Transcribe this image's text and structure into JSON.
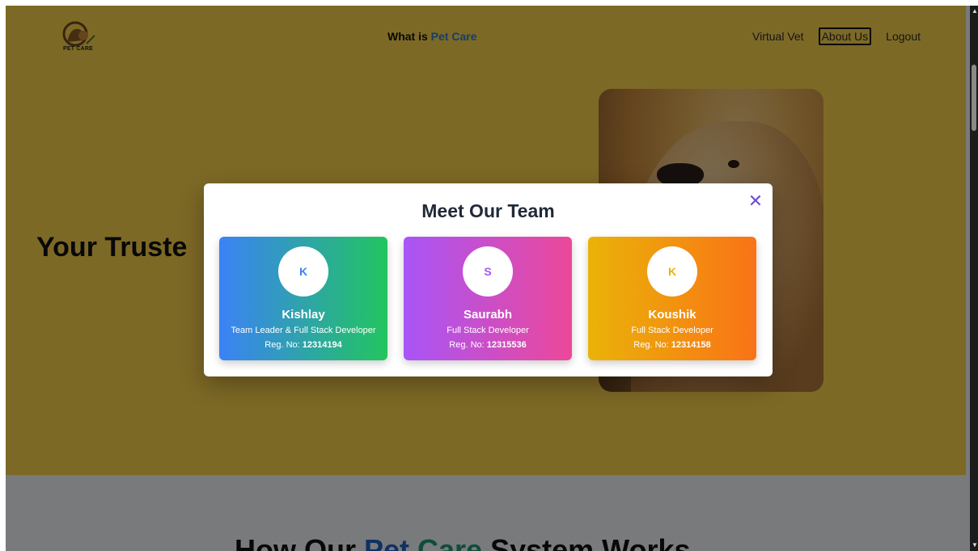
{
  "navbar": {
    "logo_text": "PET CARE",
    "center_prefix": "What is",
    "center_accent": "Pet Care",
    "links": [
      "Virtual Vet",
      "About Us",
      "Logout"
    ]
  },
  "hero": {
    "title": "Your Truste"
  },
  "section2": {
    "title_part1": "How Our ",
    "title_part2": "Pet ",
    "title_part3": "Care",
    "title_part4": " System Works"
  },
  "modal": {
    "title": "Meet Our Team",
    "close_label": "✕",
    "reg_label": "Reg. No:",
    "members": [
      {
        "initial": "K",
        "name": "Kishlay",
        "role": "Team Leader & Full Stack Developer",
        "reg": "12314194"
      },
      {
        "initial": "S",
        "name": "Saurabh",
        "role": "Full Stack Developer",
        "reg": "12315536"
      },
      {
        "initial": "K",
        "name": "Koushik",
        "role": "Full Stack Developer",
        "reg": "12314158"
      }
    ]
  },
  "colors": {
    "hero_bg": "#fbd24c",
    "accent_blue": "#2a7ad8",
    "close_purple": "#6d4fd6"
  }
}
